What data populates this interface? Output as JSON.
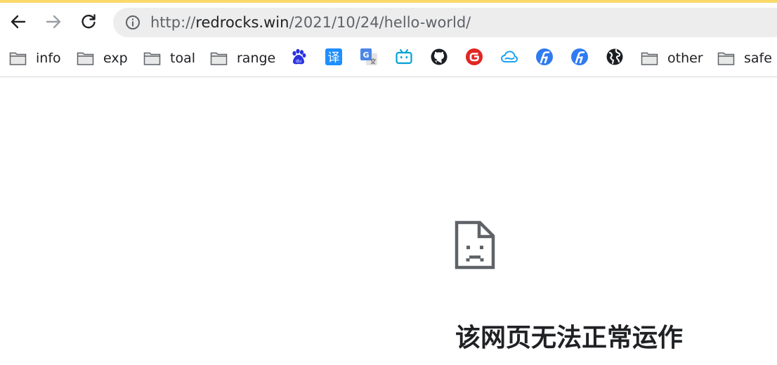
{
  "browser": {
    "url_prefix": "http://",
    "url_host": "redrocks.win",
    "url_path": "/2021/10/24/hello-world/",
    "accent_color": "#f9d96a"
  },
  "bookmarks": {
    "folders": {
      "info": "info",
      "exp": "exp",
      "toal": "toal",
      "range": "range",
      "other": "other",
      "safe": "safe"
    },
    "translate_icon_text": "译",
    "baidu_icon_text": "du",
    "google_translate_text": "G"
  },
  "error": {
    "title": "该网页无法正常运作"
  }
}
